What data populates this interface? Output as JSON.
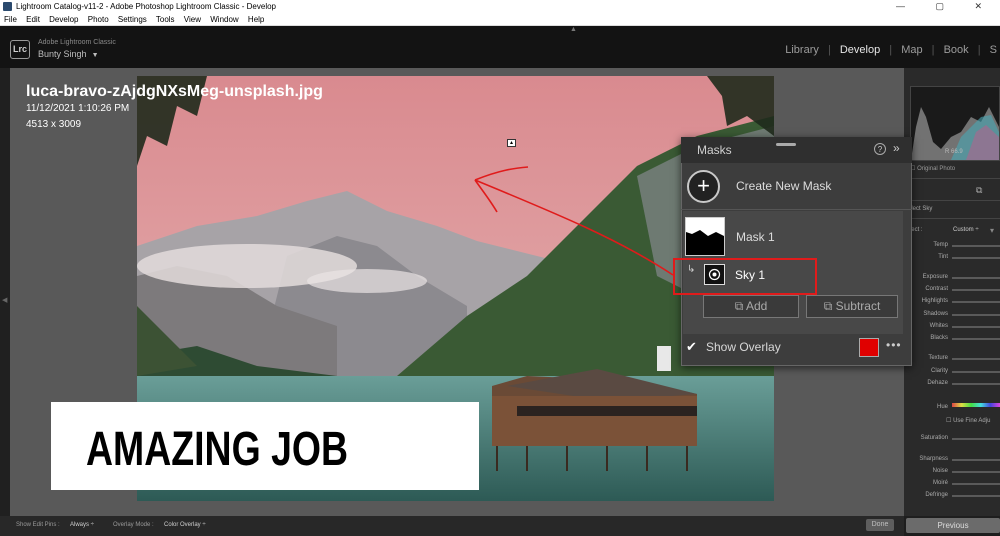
{
  "window": {
    "title": "Lightroom Catalog-v11-2 - Adobe Photoshop Lightroom Classic - Develop",
    "controls": "— ▢ ✕"
  },
  "menu": [
    "File",
    "Edit",
    "Develop",
    "Photo",
    "Settings",
    "Tools",
    "View",
    "Window",
    "Help"
  ],
  "identity": {
    "logo": "Lrc",
    "product": "Adobe Lightroom Classic",
    "user": "Bunty Singh",
    "user_caret": "▼"
  },
  "modules": {
    "library": "Library",
    "develop": "Develop",
    "map": "Map",
    "book": "Book",
    "next": "S",
    "sep": "|"
  },
  "photo_info": {
    "filename": "luca-bravo-zAjdgNXsMeg-unsplash.jpg",
    "datetime": "11/12/2021 1:10:26 PM",
    "dimensions": "4513 x 3009"
  },
  "masks_panel": {
    "title": "Masks",
    "help": "?",
    "collapse": "»",
    "create_icon": "+",
    "create_label": "Create New Mask",
    "mask1_label": "Mask 1",
    "sky1_arrow": "↳",
    "sky1_label": "Sky 1",
    "add_label": "Add",
    "subtract_label": "Subtract",
    "overlay_check": "✔",
    "show_overlay_label": "Show Overlay",
    "overlay_color": "#e00000",
    "more": "•••"
  },
  "caption": {
    "text": "AMAZING JOB"
  },
  "right_panel": {
    "hist_readout": "R    66.9",
    "original_photo": "Original Photo",
    "select_sky": "elect Sky",
    "effect_label": "ffect :",
    "effect_value": "Custom ÷",
    "adjustments": [
      "Temp",
      "Tint",
      "Exposure",
      "Contrast",
      "Highlights",
      "Shadows",
      "Whites",
      "Blacks",
      "Texture",
      "Clarity",
      "Dehaze",
      "Hue",
      "Saturation",
      "Sharpness",
      "Noise",
      "Moiré",
      "Defringe"
    ],
    "use_fine_adjust": "Use Fine Adju",
    "previous_label": "Previous"
  },
  "bottom_bar": {
    "show_edit_pins_label": "Show Edit Pins :",
    "show_edit_pins_value": "Always ÷",
    "overlay_mode_label": "Overlay Mode :",
    "overlay_mode_value": "Color Overlay ÷",
    "done_label": "Done"
  },
  "colors": {
    "overlay_red": "#e00000",
    "annotation_red": "#e01b1b",
    "panel_bg": "#3d3d3d"
  }
}
